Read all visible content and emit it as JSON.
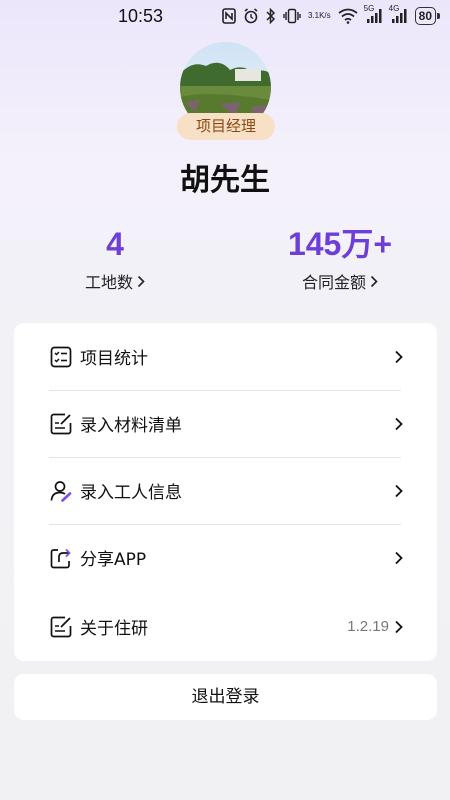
{
  "status_bar": {
    "time": "10:53",
    "net_speed_value": "3.1",
    "net_speed_unit": "K/s",
    "signal1_label": "5G",
    "signal2_label": "4G",
    "battery": "80"
  },
  "profile": {
    "role": "项目经理",
    "name": "胡先生"
  },
  "stats": [
    {
      "value": "4",
      "label": "工地数"
    },
    {
      "value": "145万+",
      "label": "合同金额"
    }
  ],
  "menu": [
    {
      "label": "项目统计",
      "icon": "checklist-icon",
      "value": ""
    },
    {
      "label": "录入材料清单",
      "icon": "edit-note-icon",
      "value": ""
    },
    {
      "label": "录入工人信息",
      "icon": "user-edit-icon",
      "value": ""
    },
    {
      "label": "分享APP",
      "icon": "share-icon",
      "value": ""
    },
    {
      "label": "关于住研",
      "icon": "edit-note-icon",
      "value": "1.2.19"
    }
  ],
  "logout_label": "退出登录",
  "colors": {
    "accent": "#6d3fd6",
    "badge_bg": "#f7e0c6",
    "badge_text": "#8a4a15"
  }
}
